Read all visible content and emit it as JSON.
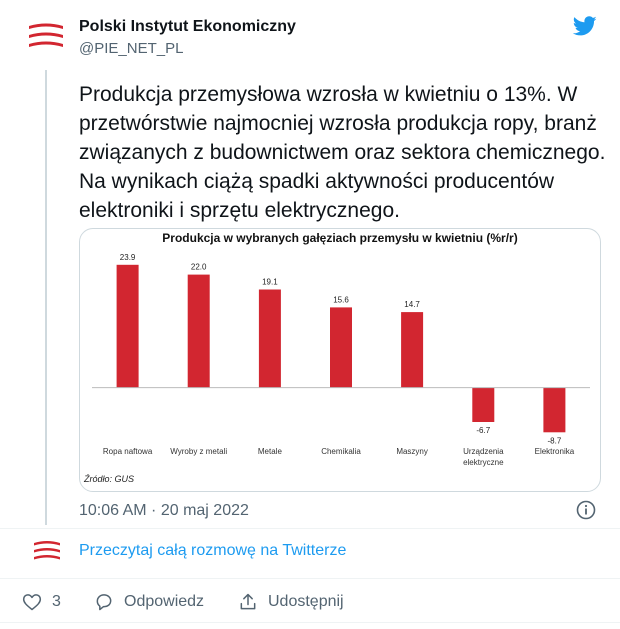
{
  "author": {
    "name": "Polski Instytut Ekonomiczny",
    "handle": "@PIE_NET_PL"
  },
  "tweet": {
    "text": "Produkcja przemysłowa wzrosła w kwietniu o 13%. W przetwórstwie najmocniej wzrosła produkcja ropy, branż związanych z budownictwem oraz sektora chemicznego. Na wynikach ciążą spadki aktywności producentów elektroniki i sprzętu elektrycznego."
  },
  "chart_data": {
    "type": "bar",
    "title": "Produkcja w wybranych gałęziach przemysłu w kwietniu (%r/r)",
    "categories": [
      "Ropa naftowa",
      "Wyroby z metali",
      "Metale",
      "Chemikalia",
      "Maszyny",
      "Urządzenia elektryczne",
      "Elektronika"
    ],
    "category_lines": [
      [
        "Ropa naftowa"
      ],
      [
        "Wyroby z metali"
      ],
      [
        "Metale"
      ],
      [
        "Chemikalia"
      ],
      [
        "Maszyny"
      ],
      [
        "Urządzenia",
        "elektryczne"
      ],
      [
        "Elektronika"
      ]
    ],
    "values": [
      23.9,
      22.0,
      19.1,
      15.6,
      14.7,
      -6.7,
      -8.7
    ],
    "value_labels": [
      "23.9",
      "22.0",
      "19.1",
      "15.6",
      "14.7",
      "-6.7",
      "-8.7"
    ],
    "bar_color": "#d22630",
    "ylim": [
      -10,
      26
    ],
    "grid": false,
    "source": "Źródło: GUS"
  },
  "timestamp": "10:06 AM · 20 maj 2022",
  "read_more": "Przeczytaj całą rozmowę na Twitterze",
  "actions": {
    "likes": "3",
    "reply_label": "Odpowiedz",
    "share_label": "Udostępnij"
  },
  "colors": {
    "brand_red": "#d22630",
    "twitter_blue": "#1d9bf0",
    "secondary_text": "#536471"
  }
}
